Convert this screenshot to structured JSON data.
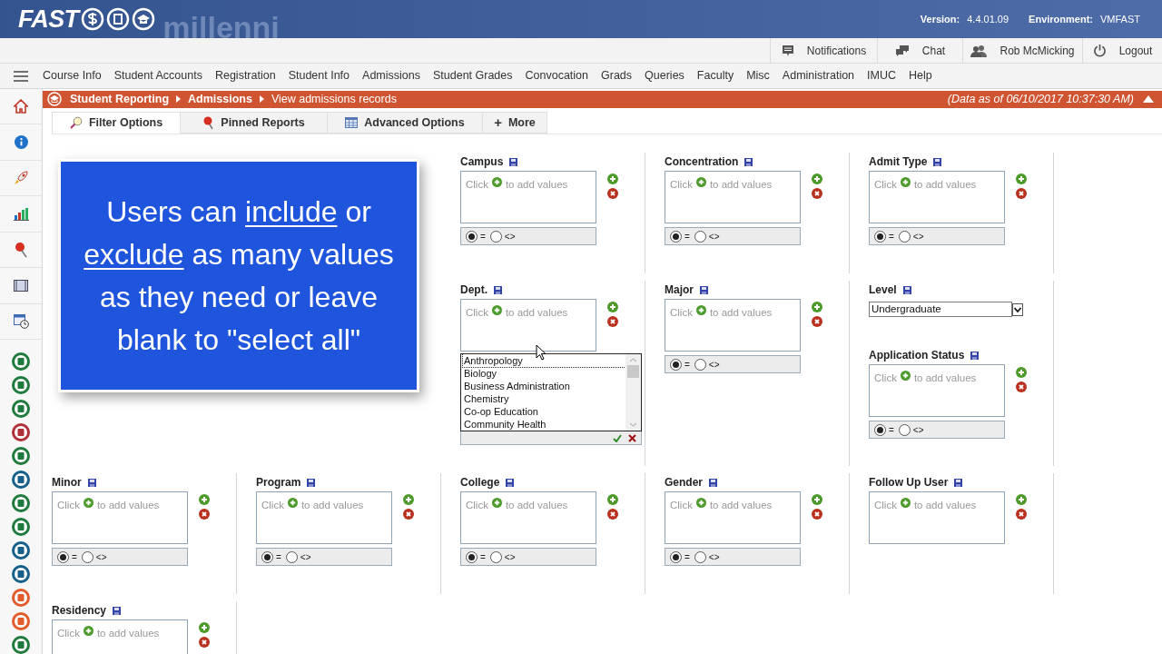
{
  "header": {
    "logo": "FAST",
    "background_text": "millenni",
    "version_label": "Version:",
    "version": "4.4.01.09",
    "environment_label": "Environment:",
    "environment": "VMFAST"
  },
  "user_bar": [
    {
      "kind": "notifications",
      "label": "Notifications"
    },
    {
      "kind": "chat",
      "label": "Chat"
    },
    {
      "kind": "user",
      "label": "Rob McMicking"
    },
    {
      "kind": "logout",
      "label": "Logout"
    }
  ],
  "menu": [
    "Course Info",
    "Student Accounts",
    "Registration",
    "Student Info",
    "Admissions",
    "Student Grades",
    "Convocation",
    "Grads",
    "Queries",
    "Faculty",
    "Misc",
    "Administration",
    "IMUC",
    "Help"
  ],
  "breadcrumb": {
    "items": [
      {
        "label": "Student Reporting",
        "current": false
      },
      {
        "label": "Admissions",
        "current": false
      },
      {
        "label": "View admissions records",
        "current": true
      }
    ],
    "data_as_of": "(Data as of 06/10/2017 10:37:30 AM)"
  },
  "tabs": [
    {
      "kind": "filter",
      "label": "Filter Options",
      "selected": true
    },
    {
      "kind": "pinned",
      "label": "Pinned Reports",
      "selected": false
    },
    {
      "kind": "advanced",
      "label": "Advanced Options",
      "selected": false
    },
    {
      "kind": "more",
      "symbol": "+",
      "label": "More",
      "selected": false
    }
  ],
  "callout": {
    "segments": [
      {
        "text": "Users can ",
        "underline": false
      },
      {
        "text": "include",
        "underline": true
      },
      {
        "text": " or ",
        "underline": false
      },
      {
        "text": "exclude",
        "underline": true
      },
      {
        "text": " as many values as they need or leave blank to \"select all\"",
        "underline": false
      }
    ]
  },
  "filter_rows": [
    {
      "cells": [
        {
          "fields": [
            {
              "kind": "multi",
              "label": "Campus",
              "placeholder_start": "Click",
              "placeholder_end": "to add values",
              "operators": [
                {
                  "label": "=",
                  "selected": true
                },
                {
                  "label": "<>",
                  "selected": false
                }
              ]
            }
          ]
        },
        {
          "fields": [
            {
              "kind": "multi",
              "label": "Concentration",
              "placeholder_start": "Click",
              "placeholder_end": "to add values",
              "operators": [
                {
                  "label": "=",
                  "selected": true
                },
                {
                  "label": "<>",
                  "selected": false
                }
              ]
            }
          ]
        },
        {
          "fields": [
            {
              "kind": "multi",
              "label": "Admit Type",
              "placeholder_start": "Click",
              "placeholder_end": "to add values",
              "operators": [
                {
                  "label": "=",
                  "selected": true
                },
                {
                  "label": "<>",
                  "selected": false
                }
              ]
            }
          ]
        }
      ]
    },
    {
      "cells": [
        {
          "fields": [
            {
              "kind": "picker",
              "label": "Dept.",
              "placeholder_start": "Click",
              "placeholder_end": "to add values",
              "options": [
                {
                  "label": "Anthropology",
                  "focused": true
                },
                {
                  "label": "Biology",
                  "focused": false
                },
                {
                  "label": "Business Administration",
                  "focused": false
                },
                {
                  "label": "Chemistry",
                  "focused": false
                },
                {
                  "label": "Co-op Education",
                  "focused": false
                },
                {
                  "label": "Community Health",
                  "focused": false
                }
              ]
            }
          ]
        },
        {
          "fields": [
            {
              "kind": "multi",
              "label": "Major",
              "placeholder_start": "Click",
              "placeholder_end": "to add values",
              "operators": [
                {
                  "label": "=",
                  "selected": true
                },
                {
                  "label": "<>",
                  "selected": false
                }
              ]
            }
          ]
        },
        {
          "fields": [
            {
              "kind": "dropdown",
              "label": "Level",
              "value": "Undergraduate"
            },
            {
              "kind": "multi",
              "label": "Application Status",
              "placeholder_start": "Click",
              "placeholder_end": "to add values",
              "operators": [
                {
                  "label": "=",
                  "selected": true
                },
                {
                  "label": "<>",
                  "selected": false
                }
              ]
            }
          ]
        }
      ]
    },
    {
      "cells": [
        {
          "fields": [
            {
              "kind": "multi",
              "label": "Minor",
              "placeholder_start": "Click",
              "placeholder_end": "to add values",
              "operators": [
                {
                  "label": "=",
                  "selected": true
                },
                {
                  "label": "<>",
                  "selected": false
                }
              ]
            }
          ]
        },
        {
          "fields": [
            {
              "kind": "multi",
              "label": "Program",
              "placeholder_start": "Click",
              "placeholder_end": "to add values",
              "operators": [
                {
                  "label": "=",
                  "selected": true
                },
                {
                  "label": "<>",
                  "selected": false
                }
              ]
            }
          ]
        },
        {
          "fields": [
            {
              "kind": "multi",
              "label": "College",
              "placeholder_start": "Click",
              "placeholder_end": "to add values",
              "operators": [
                {
                  "label": "=",
                  "selected": true
                },
                {
                  "label": "<>",
                  "selected": false
                }
              ]
            }
          ]
        },
        {
          "fields": [
            {
              "kind": "multi",
              "label": "Gender",
              "placeholder_start": "Click",
              "placeholder_end": "to add values",
              "operators": [
                {
                  "label": "=",
                  "selected": true
                },
                {
                  "label": "<>",
                  "selected": false
                }
              ]
            }
          ]
        },
        {
          "fields": [
            {
              "kind": "multi",
              "label": "Follow Up User",
              "placeholder_start": "Click",
              "placeholder_end": "to add values"
            }
          ]
        }
      ]
    },
    {
      "cells": [
        {
          "fields": [
            {
              "kind": "multi",
              "label": "Residency",
              "placeholder_start": "Click",
              "placeholder_end": "to add values"
            }
          ]
        }
      ]
    }
  ]
}
